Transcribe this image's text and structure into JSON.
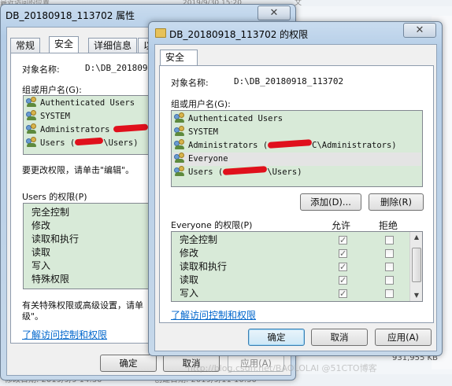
{
  "background": {
    "top_left": "最近访问的位置",
    "top_date": "2019/9/30 15:20",
    "top_right": "文",
    "bottom_left": "修改日期: 2019/9/9 14:30",
    "bottom_mid": "创建日期: 2019/9/11 10:30",
    "file_size": "931,955 KB",
    "watermark": "http://blog.csdn.net/BAOLOLAI @51CTO博客"
  },
  "back_window": {
    "title": "DB_20180918_113702 属性",
    "close_glyph": "✕",
    "tabs": [
      "常规",
      "安全",
      "详细信息",
      "以"
    ],
    "object_label": "对象名称:",
    "object_value": "D:\\DB_20180918_113702",
    "group_label": "组或用户名(G):",
    "users": [
      "Authenticated Users",
      "SYSTEM",
      "Administrators",
      "Users (",
      "\\Users)"
    ],
    "edit_hint": "要更改权限，请单击\"编辑\"。",
    "perm_label": "Users 的权限(P)",
    "perms": [
      "完全控制",
      "修改",
      "读取和执行",
      "读取",
      "写入",
      "特殊权限"
    ],
    "special_hint_1": "有关特殊权限或高级设置，请单",
    "special_hint_2": "级\"。",
    "link": "了解访问控制和权限",
    "ok": "确定",
    "cancel": "取消",
    "apply": "应用(A)"
  },
  "front_window": {
    "title": "DB_20180918_113702 的权限",
    "close_glyph": "✕",
    "tab": "安全",
    "object_label": "对象名称:",
    "object_value": "D:\\DB_20180918_113702",
    "group_label": "组或用户名(G):",
    "users": [
      {
        "name": "Authenticated Users"
      },
      {
        "name": "SYSTEM"
      },
      {
        "name": "Administrators (",
        "suffix": "C\\Administrators)"
      },
      {
        "name": "Everyone"
      },
      {
        "name": "Users (",
        "suffix": "\\Users)"
      }
    ],
    "selected_user": "Everyone",
    "add_button": "添加(D)...",
    "remove_button": "删除(R)",
    "perm_label": "Everyone 的权限(P)",
    "allow_header": "允许",
    "deny_header": "拒绝",
    "perms": [
      {
        "name": "完全控制",
        "allow": true,
        "deny": false
      },
      {
        "name": "修改",
        "allow": true,
        "deny": false
      },
      {
        "name": "读取和执行",
        "allow": true,
        "deny": false
      },
      {
        "name": "读取",
        "allow": true,
        "deny": false
      },
      {
        "name": "写入",
        "allow": true,
        "deny": false
      }
    ],
    "link": "了解访问控制和权限",
    "ok": "确定",
    "cancel": "取消",
    "apply": "应用(A)"
  },
  "colors": {
    "list_bg": "#d8ead8",
    "link": "#0066cc",
    "redaction": "#e0101c"
  }
}
